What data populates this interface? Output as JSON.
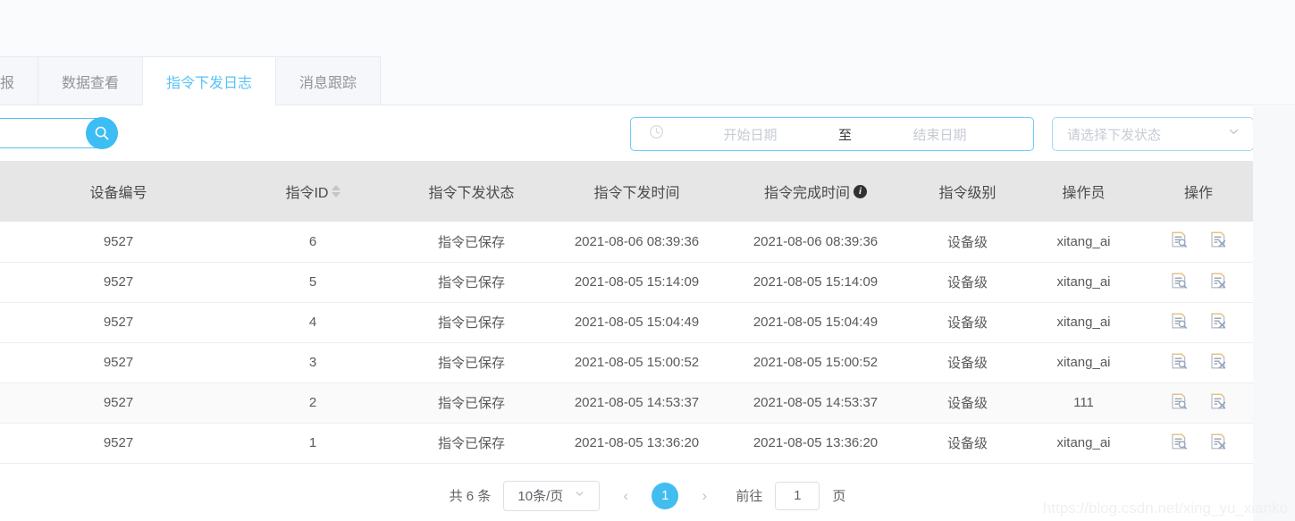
{
  "tabs": [
    {
      "label": "报",
      "active": false
    },
    {
      "label": "数据查看",
      "active": false
    },
    {
      "label": "指令下发日志",
      "active": true
    },
    {
      "label": "消息跟踪",
      "active": false
    }
  ],
  "toolbar": {
    "search_value": "",
    "search_placeholder": "",
    "search_icon": "search-icon",
    "daterange": {
      "icon": "clock-icon",
      "start_placeholder": "开始日期",
      "separator": "至",
      "end_placeholder": "结束日期"
    },
    "status_select": {
      "placeholder": "请选择下发状态",
      "icon": "chevron-down-icon"
    }
  },
  "table": {
    "columns": [
      {
        "label": "设备编号",
        "sortable": false,
        "info": false
      },
      {
        "label": "指令ID",
        "sortable": true,
        "info": false
      },
      {
        "label": "指令下发状态",
        "sortable": false,
        "info": false
      },
      {
        "label": "指令下发时间",
        "sortable": false,
        "info": false
      },
      {
        "label": "指令完成时间",
        "sortable": false,
        "info": true
      },
      {
        "label": "指令级别",
        "sortable": false,
        "info": false
      },
      {
        "label": "操作员",
        "sortable": false,
        "info": false
      },
      {
        "label": "操作",
        "sortable": false,
        "info": false
      }
    ],
    "rows": [
      {
        "device": "9527",
        "cmd_id": "6",
        "status": "指令已保存",
        "sent_time": "2021-08-06 08:39:36",
        "done_time": "2021-08-06 08:39:36",
        "level": "设备级",
        "operator": "xitang_ai",
        "hovered": false
      },
      {
        "device": "9527",
        "cmd_id": "5",
        "status": "指令已保存",
        "sent_time": "2021-08-05 15:14:09",
        "done_time": "2021-08-05 15:14:09",
        "level": "设备级",
        "operator": "xitang_ai",
        "hovered": false
      },
      {
        "device": "9527",
        "cmd_id": "4",
        "status": "指令已保存",
        "sent_time": "2021-08-05 15:04:49",
        "done_time": "2021-08-05 15:04:49",
        "level": "设备级",
        "operator": "xitang_ai",
        "hovered": false
      },
      {
        "device": "9527",
        "cmd_id": "3",
        "status": "指令已保存",
        "sent_time": "2021-08-05 15:00:52",
        "done_time": "2021-08-05 15:00:52",
        "level": "设备级",
        "operator": "xitang_ai",
        "hovered": false
      },
      {
        "device": "9527",
        "cmd_id": "2",
        "status": "指令已保存",
        "sent_time": "2021-08-05 14:53:37",
        "done_time": "2021-08-05 14:53:37",
        "level": "设备级",
        "operator": "111",
        "hovered": true
      },
      {
        "device": "9527",
        "cmd_id": "1",
        "status": "指令已保存",
        "sent_time": "2021-08-05 13:36:20",
        "done_time": "2021-08-05 13:36:20",
        "level": "设备级",
        "operator": "xitang_ai",
        "hovered": false
      }
    ],
    "row_action_icons": [
      "document-search-icon",
      "document-delete-icon"
    ]
  },
  "pagination": {
    "total_label": "共 6 条",
    "page_size_label": "10条/页",
    "prev_label": "‹",
    "next_label": "›",
    "current_page": "1",
    "jump_prefix": "前往",
    "jump_value": "1",
    "jump_suffix": "页"
  },
  "watermark": "https://blog.csdn.net/xing_yu_xianko",
  "colors": {
    "accent": "#3cbdf4",
    "active_tab_text": "#56c3f5",
    "header_bg": "#e6e6e6",
    "placeholder": "#c6cbd4"
  }
}
